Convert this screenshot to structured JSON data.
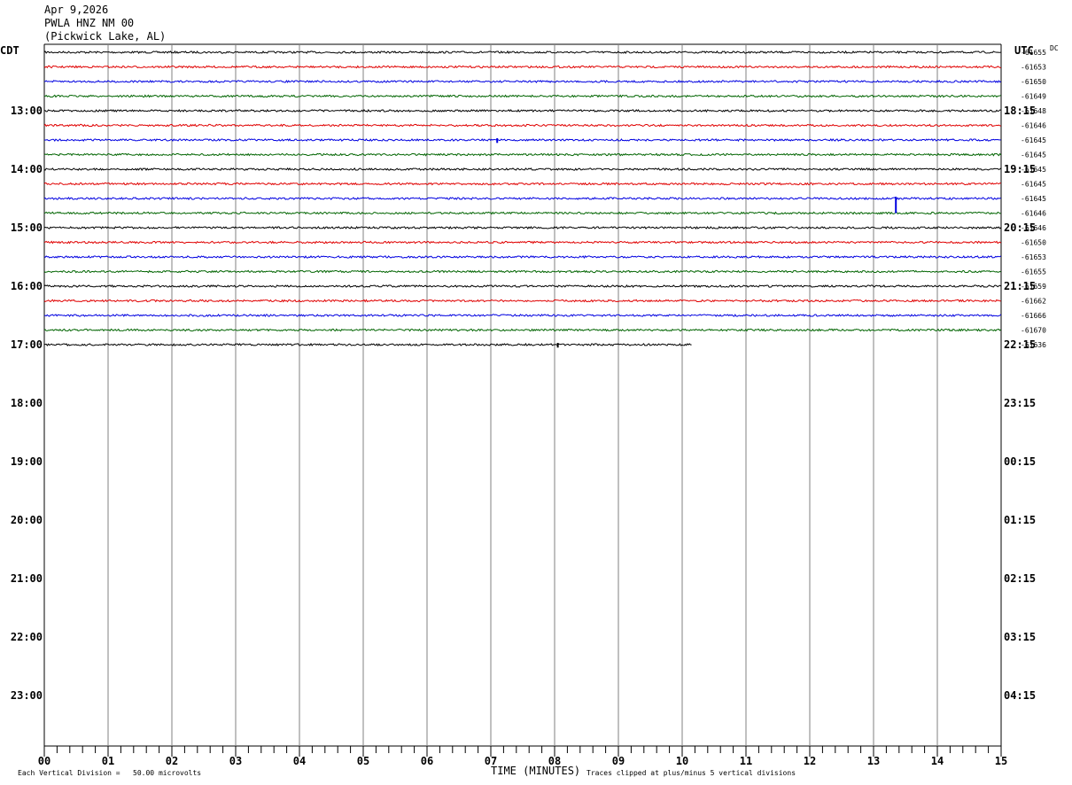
{
  "header": {
    "date": "Apr 9,2026",
    "station": "PWLA HNZ NM 00",
    "location": "(Pickwick Lake, AL)"
  },
  "left_tz": "CDT",
  "right_tz": "UTC",
  "dc_label": "DC",
  "footer": {
    "scale_note": "Each Vertical Division =   50.00 microvolts",
    "xlabel": "TIME (MINUTES)",
    "clip_note": "Traces clipped at plus/minus 5 vertical divisions"
  },
  "colors": {
    "trace_cycle": [
      "#000000",
      "#e00000",
      "#0000e0",
      "#006400"
    ],
    "grid": "#808080"
  },
  "chart_data": {
    "type": "line",
    "title": "PWLA HNZ NM 00",
    "xlabel": "TIME (MINUTES)",
    "x_ticks": [
      "00",
      "01",
      "02",
      "03",
      "04",
      "05",
      "06",
      "07",
      "08",
      "09",
      "10",
      "11",
      "12",
      "13",
      "14",
      "15"
    ],
    "xlim": [
      0,
      15
    ],
    "left_hour_labels": [
      "13:00",
      "14:00",
      "15:00",
      "16:00",
      "17:00",
      "18:00",
      "19:00",
      "20:00",
      "21:00",
      "22:00",
      "23:00"
    ],
    "right_hour_labels": [
      "18:15",
      "19:15",
      "20:15",
      "21:15",
      "22:15",
      "23:15",
      "00:15",
      "01:15",
      "02:15",
      "03:15",
      "04:15"
    ],
    "dc_offsets": [
      "-61655",
      "-61653",
      "-61650",
      "-61649",
      "-61648",
      "-61646",
      "-61645",
      "-61645",
      "-61645",
      "-61645",
      "-61645",
      "-61646",
      "-61646",
      "-61650",
      "-61653",
      "-61655",
      "-61659",
      "-61662",
      "-61666",
      "-61670",
      "-61636"
    ],
    "traces_end_minute": [
      15,
      15,
      15,
      15,
      15,
      15,
      15,
      15,
      15,
      15,
      15,
      15,
      15,
      15,
      15,
      15,
      15,
      15,
      15,
      15,
      10.15
    ],
    "events": [
      {
        "trace": 10,
        "minute": 13.35,
        "amplitude_div": 5
      },
      {
        "trace": 6,
        "minute": 7.1,
        "amplitude_div": 1
      },
      {
        "trace": 20,
        "minute": 8.05,
        "amplitude_div": 1
      }
    ],
    "grid": true
  }
}
